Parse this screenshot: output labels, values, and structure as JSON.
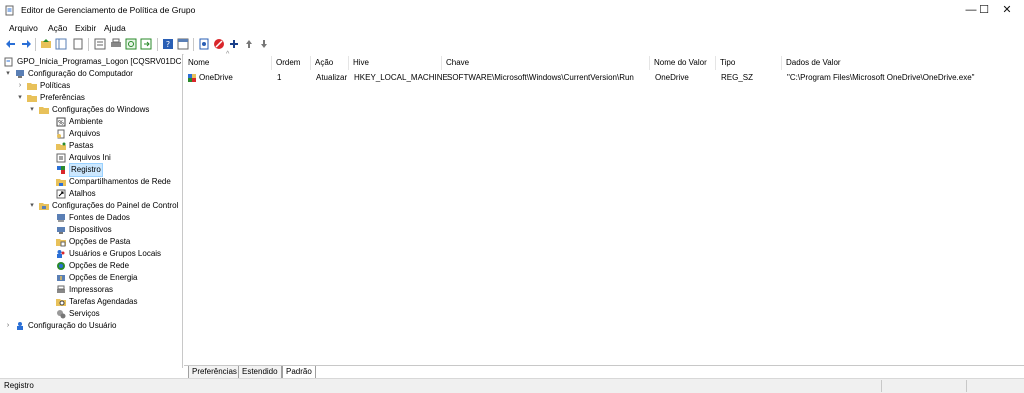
{
  "window": {
    "title": "Editor de Gerenciamento de Política de Grupo",
    "minimize": "—",
    "maximize": "☐",
    "close": "✕"
  },
  "menu": {
    "items": [
      "Arquivo",
      "Ação",
      "Exibir",
      "Ajuda"
    ]
  },
  "tree": {
    "nodes": [
      {
        "label": "GPO_Inicia_Programas_Logon [CQSRV01DC.CQ",
        "icon": "gpo-icon",
        "expander": ""
      },
      {
        "label": "Configuração do Computador",
        "icon": "computer-icon",
        "expander": "▾"
      },
      {
        "label": "Políticas",
        "icon": "folder-icon",
        "expander": "›"
      },
      {
        "label": "Preferências",
        "icon": "folder-icon",
        "expander": "▾"
      },
      {
        "label": "Configurações do Windows",
        "icon": "folder-icon",
        "expander": "▾"
      },
      {
        "label": "Ambiente",
        "icon": "environment-icon",
        "expander": ""
      },
      {
        "label": "Arquivos",
        "icon": "files-icon",
        "expander": ""
      },
      {
        "label": "Pastas",
        "icon": "folders-icon",
        "expander": ""
      },
      {
        "label": "Arquivos Ini",
        "icon": "ini-files-icon",
        "expander": ""
      },
      {
        "label": "Registro",
        "icon": "registry-icon",
        "expander": ""
      },
      {
        "label": "Compartilhamentos de Rede",
        "icon": "network-shares-icon",
        "expander": ""
      },
      {
        "label": "Atalhos",
        "icon": "shortcuts-icon",
        "expander": ""
      },
      {
        "label": "Configurações do Painel de Control",
        "icon": "control-panel-icon",
        "expander": "▾"
      },
      {
        "label": "Fontes de Dados",
        "icon": "data-sources-icon",
        "expander": ""
      },
      {
        "label": "Dispositivos",
        "icon": "devices-icon",
        "expander": ""
      },
      {
        "label": "Opções de Pasta",
        "icon": "folder-options-icon",
        "expander": ""
      },
      {
        "label": "Usuários e Grupos Locais",
        "icon": "local-users-icon",
        "expander": ""
      },
      {
        "label": "Opções de Rede",
        "icon": "network-options-icon",
        "expander": ""
      },
      {
        "label": "Opções de Energia",
        "icon": "power-options-icon",
        "expander": ""
      },
      {
        "label": "Impressoras",
        "icon": "printers-icon",
        "expander": ""
      },
      {
        "label": "Tarefas Agendadas",
        "icon": "scheduled-tasks-icon",
        "expander": ""
      },
      {
        "label": "Serviços",
        "icon": "services-icon",
        "expander": ""
      },
      {
        "label": "Configuração do Usuário",
        "icon": "user-config-icon",
        "expander": "›"
      }
    ]
  },
  "list": {
    "columns": [
      "Nome",
      "Ordem",
      "Ação",
      "Hive",
      "Chave",
      "Nome do Valor",
      "Tipo",
      "Dados de Valor"
    ],
    "sort_indicator": "^",
    "rows": [
      {
        "nome": "OneDrive",
        "ordem": "1",
        "acao": "Atualizar",
        "hive": "HKEY_LOCAL_MACHINE",
        "chave": "SOFTWARE\\Microsoft\\Windows\\CurrentVersion\\Run",
        "nome_valor": "OneDrive",
        "tipo": "REG_SZ",
        "dados": "\"C:\\Program Files\\Microsoft OneDrive\\OneDrive.exe\""
      }
    ]
  },
  "tabs": [
    "Preferências",
    "Estendido",
    "Padrão"
  ],
  "status": {
    "text": "Registro"
  },
  "colors": {
    "accent_blue": "#2a6fd6",
    "selection": "#cce8ff",
    "folder": "#e8c15a"
  }
}
